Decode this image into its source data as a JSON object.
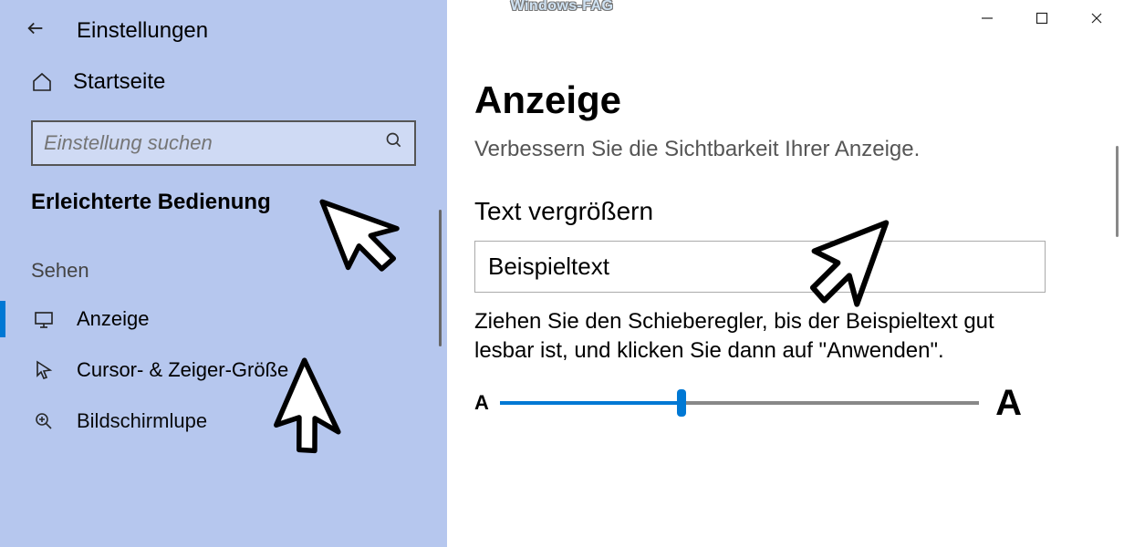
{
  "watermark": "Windows-FAG",
  "window": {
    "title": "Einstellungen"
  },
  "sidebar": {
    "home_label": "Startseite",
    "search_placeholder": "Einstellung suchen",
    "category_title": "Erleichterte Bedienung",
    "group_label": "Sehen",
    "items": [
      {
        "key": "display",
        "label": "Anzeige",
        "icon": "monitor",
        "active": true
      },
      {
        "key": "cursor",
        "label": "Cursor- & Zeiger-Größe",
        "icon": "pointer",
        "active": false
      },
      {
        "key": "magnifier",
        "label": "Bildschirmlupe",
        "icon": "magnifier",
        "active": false
      }
    ]
  },
  "main": {
    "page_title": "Anzeige",
    "page_subtitle": "Verbessern Sie die Sichtbarkeit Ihrer Anzeige.",
    "section_header": "Text vergrößern",
    "sample_text": "Beispieltext",
    "slider_description": "Ziehen Sie den Schieberegler, bis der Beispieltext gut lesbar ist, und klicken Sie dann auf \"Anwenden\".",
    "slider_min_label": "A",
    "slider_max_label": "A",
    "slider_value_percent": 38
  }
}
